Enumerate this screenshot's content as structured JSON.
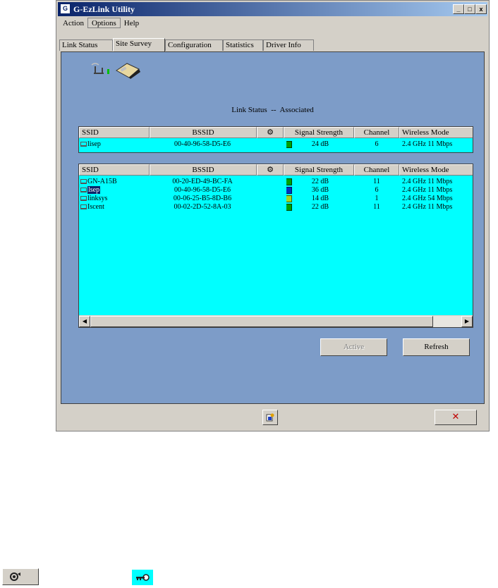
{
  "window": {
    "title": "G-EzLink Utility",
    "minimize_glyph": "_",
    "maximize_glyph": "□",
    "close_glyph": "x"
  },
  "menu": [
    "Action",
    "Options",
    "Help"
  ],
  "tabs": [
    "Link Status",
    "Site Survey",
    "Configuration",
    "Statistics",
    "Driver Info"
  ],
  "active_tab": "Site Survey",
  "link_status": {
    "label": "Link Status",
    "separator": "--",
    "value": "Associated"
  },
  "columns": [
    "SSID",
    "BSSID",
    "",
    "Signal Strength",
    "Channel",
    "Wireless Mode"
  ],
  "connected": [
    {
      "ssid": "lisep",
      "bssid": "00-40-96-58-D5-E6",
      "signal": "24 dB",
      "channel": "6",
      "mode": "2.4 GHz 11 Mbps",
      "signal_color": "green"
    }
  ],
  "networks": [
    {
      "ssid": "GN-A15B",
      "bssid": "00-20-ED-49-BC-FA",
      "signal": "22 dB",
      "channel": "11",
      "mode": "2.4 GHz 11 Mbps",
      "selected": false,
      "signal_color": "green"
    },
    {
      "ssid": "lsep",
      "bssid": "00-40-96-58-D5-E6",
      "signal": "36 dB",
      "channel": "6",
      "mode": "2.4 GHz 11 Mbps",
      "selected": true,
      "signal_color": "blue"
    },
    {
      "ssid": "linksys",
      "bssid": "00-06-25-B5-8D-B6",
      "signal": "14 dB",
      "channel": "1",
      "mode": "2.4 GHz 54 Mbps",
      "selected": false,
      "signal_color": "lime"
    },
    {
      "ssid": "Iscent",
      "bssid": "00-02-2D-52-8A-03",
      "signal": "22 dB",
      "channel": "11",
      "mode": "2.4 GHz 11 Mbps",
      "selected": false,
      "signal_color": "green"
    }
  ],
  "buttons": {
    "active": "Active",
    "refresh": "Refresh",
    "close_glyph": "✕"
  },
  "colors": {
    "panel": "#7d9cc8",
    "list": "#00ffff",
    "selection": "#0a246a",
    "title_bar": "#0a246a"
  },
  "icons": [
    "antenna-icon",
    "wireless-card-icon",
    "security-icon",
    "key-icon",
    "help-icon"
  ]
}
